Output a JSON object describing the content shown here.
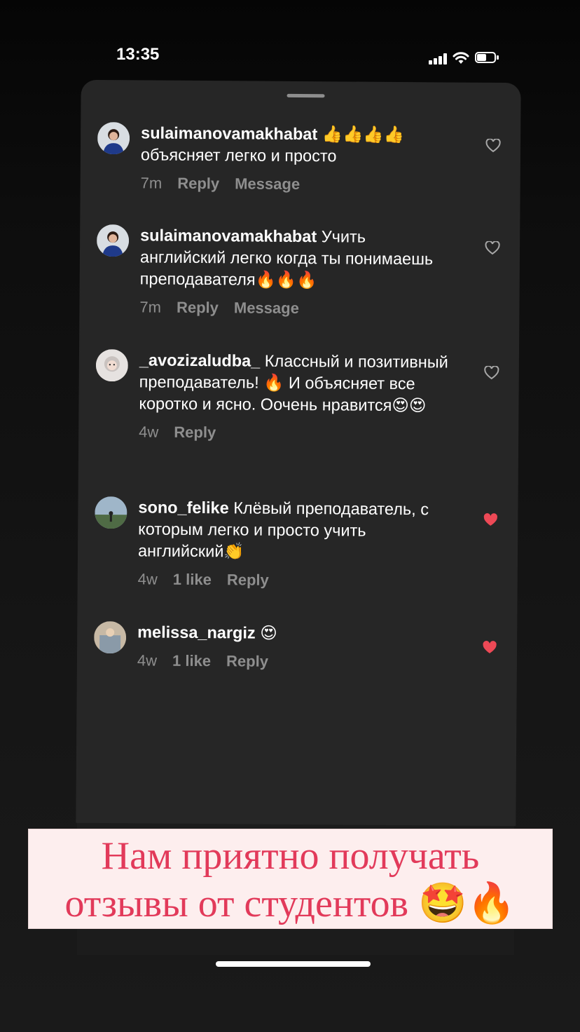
{
  "status_bar": {
    "time": "13:35"
  },
  "comments": [
    {
      "username": "sulaimanovamakhabat",
      "text": " 👍👍👍👍 объясняет легко и просто",
      "time": "7m",
      "likes": "",
      "actions": [
        "Reply",
        "Message"
      ],
      "liked": false
    },
    {
      "username": "sulaimanovamakhabat",
      "text": " Учить английский легко когда ты понимаешь преподавателя🔥🔥🔥",
      "time": "7m",
      "likes": "",
      "actions": [
        "Reply",
        "Message"
      ],
      "liked": false
    },
    {
      "username": "_avozizaludba_",
      "text": " Классный и позитивный преподаватель! 🔥 И объясняет все коротко и ясно. Оочень нравится😍😍",
      "time": "4w",
      "likes": "",
      "actions": [
        "Reply"
      ],
      "liked": false
    },
    {
      "username": "sono_felike",
      "text": " Клёвый преподаватель, с которым легко и просто учить английский👏",
      "time": "4w",
      "likes": "1 like",
      "actions": [
        "Reply"
      ],
      "liked": true
    },
    {
      "username": "melissa_nargiz",
      "text": " 😍",
      "time": "4w",
      "likes": "1 like",
      "actions": [
        "Reply"
      ],
      "liked": true
    }
  ],
  "banner": {
    "line1": "Нам приятно получать",
    "line2": "отзывы от студентов 🤩🔥"
  },
  "colors": {
    "heart_liked": "#ed4956",
    "heart_outline": "#a8a8a8",
    "banner_text": "#e23a5a"
  }
}
